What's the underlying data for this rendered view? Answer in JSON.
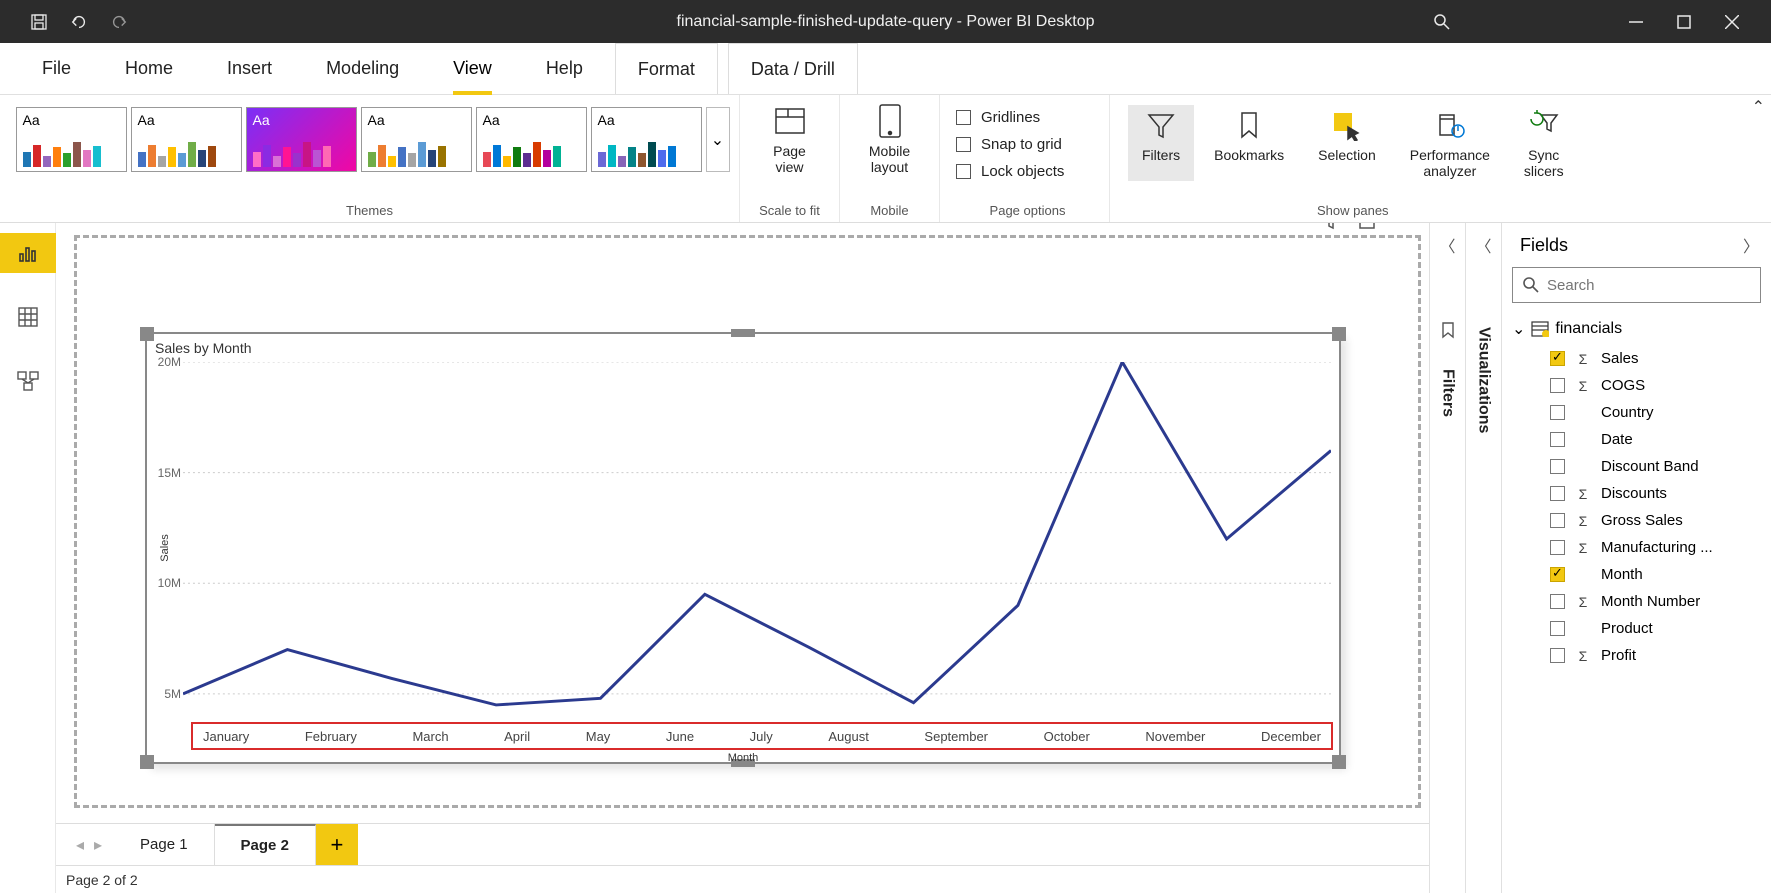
{
  "titlebar": {
    "title": "financial-sample-finished-update-query - Power BI Desktop"
  },
  "menu": {
    "file": "File",
    "home": "Home",
    "insert": "Insert",
    "modeling": "Modeling",
    "view": "View",
    "help": "Help",
    "format": "Format",
    "datadrill": "Data / Drill"
  },
  "ribbon": {
    "themes_label": "Themes",
    "scale_label": "Scale to fit",
    "page_view": "Page\nview",
    "mobile_layout": "Mobile\nlayout",
    "mobile_label": "Mobile",
    "gridlines": "Gridlines",
    "snap": "Snap to grid",
    "lock": "Lock objects",
    "page_options_label": "Page options",
    "filters": "Filters",
    "bookmarks": "Bookmarks",
    "selection": "Selection",
    "perf": "Performance\nanalyzer",
    "sync": "Sync\nslicers",
    "show_panes_label": "Show panes"
  },
  "collapsed": {
    "filters": "Filters",
    "visualizations": "Visualizations"
  },
  "fields_pane": {
    "title": "Fields",
    "placeholder": "Search",
    "table": "financials",
    "fields": [
      {
        "name": "Sales",
        "sigma": true,
        "checked": true
      },
      {
        "name": "COGS",
        "sigma": true,
        "checked": false
      },
      {
        "name": "Country",
        "sigma": false,
        "checked": false
      },
      {
        "name": "Date",
        "sigma": false,
        "checked": false
      },
      {
        "name": "Discount Band",
        "sigma": false,
        "checked": false
      },
      {
        "name": "Discounts",
        "sigma": true,
        "checked": false
      },
      {
        "name": "Gross Sales",
        "sigma": true,
        "checked": false
      },
      {
        "name": "Manufacturing ...",
        "sigma": true,
        "checked": false
      },
      {
        "name": "Month",
        "sigma": false,
        "checked": true
      },
      {
        "name": "Month Number",
        "sigma": true,
        "checked": false
      },
      {
        "name": "Product",
        "sigma": false,
        "checked": false
      },
      {
        "name": "Profit",
        "sigma": true,
        "checked": false
      }
    ]
  },
  "pages": {
    "p1": "Page 1",
    "p2": "Page 2",
    "status": "Page 2 of 2"
  },
  "chart_data": {
    "type": "line",
    "title": "Sales by Month",
    "xlabel": "Month",
    "ylabel": "Sales",
    "ylim": [
      4000000,
      20000000
    ],
    "yticks": [
      "5M",
      "10M",
      "15M",
      "20M"
    ],
    "categories": [
      "January",
      "February",
      "March",
      "April",
      "May",
      "June",
      "July",
      "August",
      "September",
      "October",
      "November",
      "December"
    ],
    "values": [
      5000000,
      7000000,
      5700000,
      4500000,
      4800000,
      9500000,
      7100000,
      4600000,
      9000000,
      20000000,
      12000000,
      16000000
    ]
  }
}
